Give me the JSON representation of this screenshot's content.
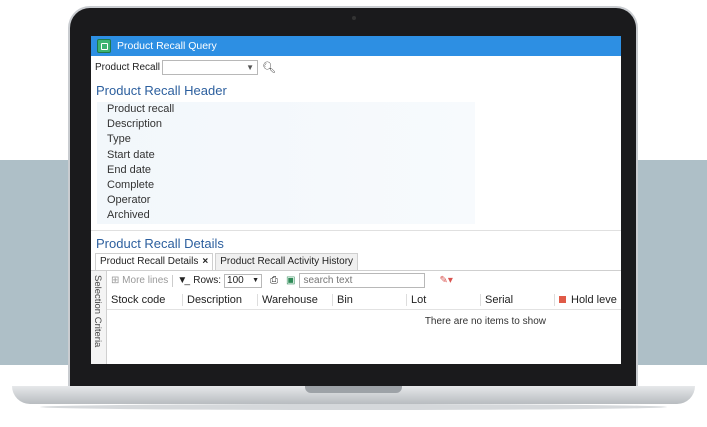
{
  "window": {
    "title": "Product Recall Query"
  },
  "filter": {
    "label": "Product Recall",
    "value": ""
  },
  "header": {
    "title": "Product Recall Header",
    "fields": [
      "Product recall",
      "Description",
      "Type",
      "Start date",
      "End date",
      "Complete",
      "Operator",
      "Archived"
    ]
  },
  "details": {
    "title": "Product Recall Details",
    "tabs": [
      {
        "label": "Product Recall Details",
        "close": "×"
      },
      {
        "label": "Product Recall Activity History"
      }
    ],
    "side_panel": "Selection Criteria",
    "toolbar": {
      "more_lines": "More lines",
      "rows_label": "Rows:",
      "rows_value": "100",
      "search_placeholder": "search text"
    },
    "columns": [
      "Stock code",
      "Description",
      "Warehouse",
      "Bin",
      "Lot",
      "Serial",
      "Hold leve"
    ],
    "empty_message": "There are no items to show"
  },
  "colors": {
    "titlebar": "#2d8fe3",
    "section_title": "#2c5f9e",
    "background_band": "#aebfc7"
  }
}
